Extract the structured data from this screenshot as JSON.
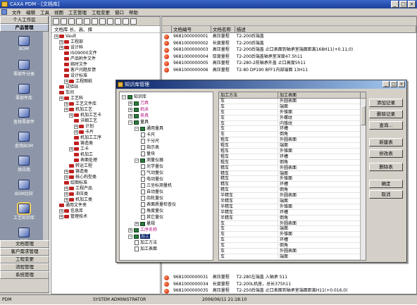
{
  "app": {
    "title": "CAXA PDM - [文档库]"
  },
  "menu": [
    "文件",
    "编辑",
    "工具",
    "视图",
    "工艺管理",
    "工程变更",
    "窗口",
    "帮助"
  ],
  "winctl": [
    "_",
    "□",
    "×"
  ],
  "left": {
    "top_buttons": [
      "个人工作区",
      "产品管理"
    ],
    "nav_items": [
      "BOM",
      "零部件分类",
      "零部件库",
      "查找零部件",
      "查找BOM",
      "供应商",
      "BOM比较",
      "工艺知识库",
      "工艺"
    ],
    "bottom_buttons": [
      "文档管理",
      "客户需求管理",
      "工程变更",
      "流程管理",
      "系统管理"
    ]
  },
  "tree": {
    "header": "文档库  长、高、择",
    "nodes": [
      "Vault",
      "工程部",
      "设计科",
      "ISO9000文件",
      "产品附件文件",
      "临时文件",
      "客户问题反馈",
      "设计标准",
      "工程图纸",
      "试验站",
      "车间",
      "工艺科",
      "工艺文件库",
      "机加工艺",
      "机加工艺卡",
      "详细工艺",
      "计划",
      "卡片",
      "机加工工序",
      "铸造类",
      "工卡",
      "机加工",
      "表面处理",
      "转运工程",
      "铸造类",
      "核心构型类",
      "绘图标准",
      "工程产品",
      "冲压类",
      "机加工类",
      "通用文件夹",
      "信息库",
      "管理技术"
    ]
  },
  "list": {
    "columns": [
      "文档编号",
      "文档名称",
      "描述"
    ],
    "rows": [
      [
        "9681000000001",
        "高压量程",
        "T2-200后端盖"
      ],
      [
        "9681000000002",
        "长度量程",
        "T2-200后端盖"
      ],
      [
        "9681000000003",
        "高压量程",
        "T2-200后端盖 止口表面到轴承室端面距离168H11(+0.11,0)"
      ],
      [
        "9681000000004",
        "厚度量程",
        "T2-200后端盖轴承室深度47.5h11"
      ],
      [
        "9681000000005",
        "高压量程",
        "T2-280-2前轴承外盖 止口高度5h11"
      ],
      [
        "9681000000006",
        "高压量程",
        "T2-80 DP190 BFF1内部端面 13H11"
      ],
      [
        "9681000000031",
        "高压量程",
        "T2-280左端盖 入轴承 511"
      ],
      [
        "9681000000034",
        "长度量程",
        "T2-200L机座，总长375h11"
      ],
      [
        "9681000000035",
        "高压量程",
        "T2-250后端盖 止口表面到轴承室端面距离H11(+0.016,0)"
      ]
    ]
  },
  "dialog": {
    "title": "知识库管理",
    "tree": [
      "知识库",
      "刀具",
      "机床",
      "夹具",
      "量具",
      "通用量具",
      "卡尺",
      "千分尺",
      "指示表",
      "量块",
      "测量仪器",
      "光学量仪",
      "气动量仪",
      "电动量仪",
      "三坐标测量机",
      "自动量仪",
      "齿轮量仪",
      "表面质量检查仪",
      "角度量仪",
      "其它量仪",
      "量规",
      "工序名称",
      "加工",
      "加工方法",
      "加工表面"
    ],
    "grid_columns": [
      "加工方法",
      "加工表面"
    ],
    "grid_rows": [
      [
        "车",
        "外圆表面"
      ],
      [
        "车",
        "端面"
      ],
      [
        "车",
        "外锥面"
      ],
      [
        "车",
        "外螺纹"
      ],
      [
        "车",
        "内锥纹"
      ],
      [
        "车",
        "环槽"
      ],
      [
        "车",
        "倒角"
      ],
      [
        "粗车",
        "外圆表面"
      ],
      [
        "粗车",
        "端面"
      ],
      [
        "粗车",
        "外锥面"
      ],
      [
        "粗车",
        "环槽"
      ],
      [
        "粗车",
        "倒角"
      ],
      [
        "精车",
        "外圆表面"
      ],
      [
        "精车",
        "端面"
      ],
      [
        "精车",
        "外锥面"
      ],
      [
        "精车",
        "环槽"
      ],
      [
        "精车",
        "倒角"
      ],
      [
        "半精车",
        "外圆表面"
      ],
      [
        "半精车",
        "端面"
      ],
      [
        "半精车",
        "外锥面"
      ],
      [
        "半精车",
        "环槽"
      ],
      [
        "半精车",
        "倒角"
      ],
      [
        "车",
        "外圆表面"
      ],
      [
        "车",
        "端面"
      ],
      [
        "车",
        "外锥面"
      ],
      [
        "车",
        "环槽"
      ],
      [
        "车",
        "倒角"
      ],
      [
        "车",
        "外圆表面"
      ],
      [
        "车",
        "端面"
      ]
    ],
    "buttons": [
      "添加记录",
      "删除记录",
      "查询...",
      "新建表",
      "修改表",
      "删除表",
      "确定",
      "取消"
    ]
  },
  "status": [
    "PDM",
    "SYSTEM ADMINISTRATOR",
    "2006/06/11 21:18:10"
  ]
}
